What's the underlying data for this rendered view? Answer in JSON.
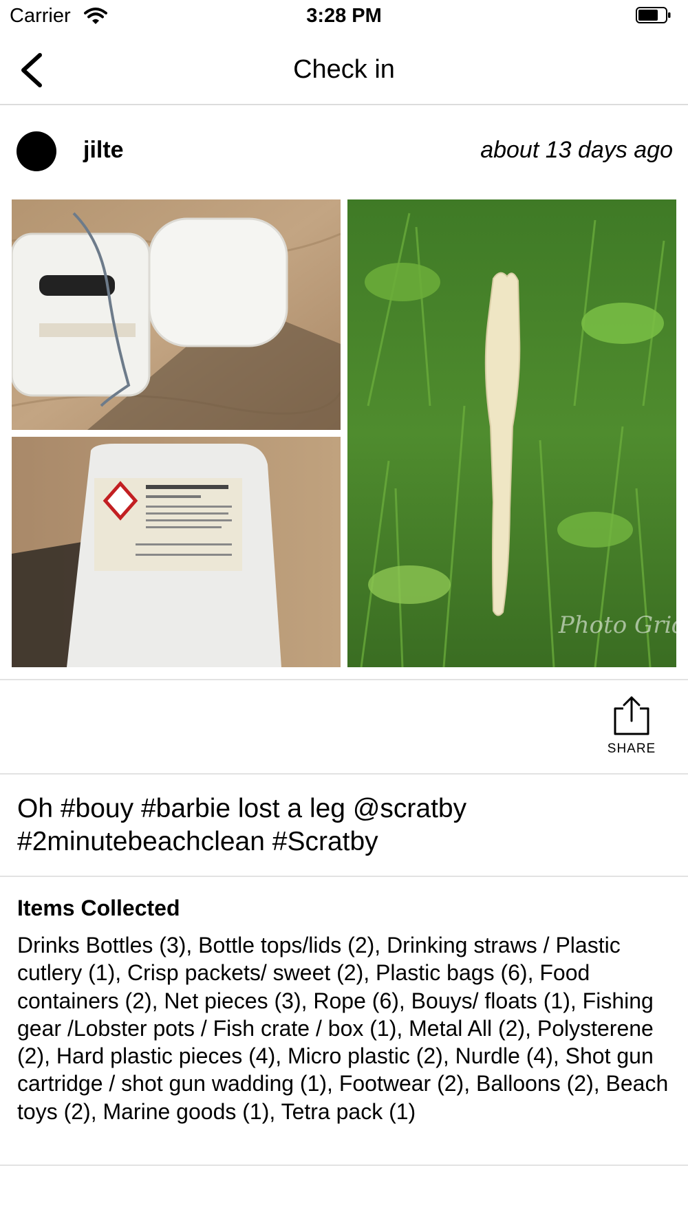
{
  "status_bar": {
    "carrier": "Carrier",
    "time": "3:28 PM"
  },
  "nav": {
    "title": "Check in",
    "back_icon": "chevron-left-icon"
  },
  "post": {
    "username": "jilte",
    "timestamp": "about 13 days ago",
    "caption": "Oh #bouy #barbie lost a leg @scratby #2minutebeachclean #Scratby",
    "photos": [
      "white jerrycans on sand",
      "aluminium sulphate container label",
      "doll leg on grass"
    ]
  },
  "share": {
    "label": "SHARE",
    "icon": "share-icon"
  },
  "items": {
    "heading": "Items Collected",
    "text": "Drinks Bottles (3), Bottle tops/lids (2), Drinking straws / Plastic cutlery (1), Crisp packets/ sweet (2), Plastic bags (6), Food containers (2), Net pieces (3), Rope  (6), Bouys/ floats (1), Fishing gear /Lobster pots / Fish crate / box (1), Metal All (2), Polysterene (2), Hard plastic pieces (4), Micro plastic  (2), Nurdle (4), Shot gun cartridge / shot gun wadding (1), Footwear (2), Balloons  (2), Beach toys (2), Marine goods (1), Tetra pack (1)"
  }
}
